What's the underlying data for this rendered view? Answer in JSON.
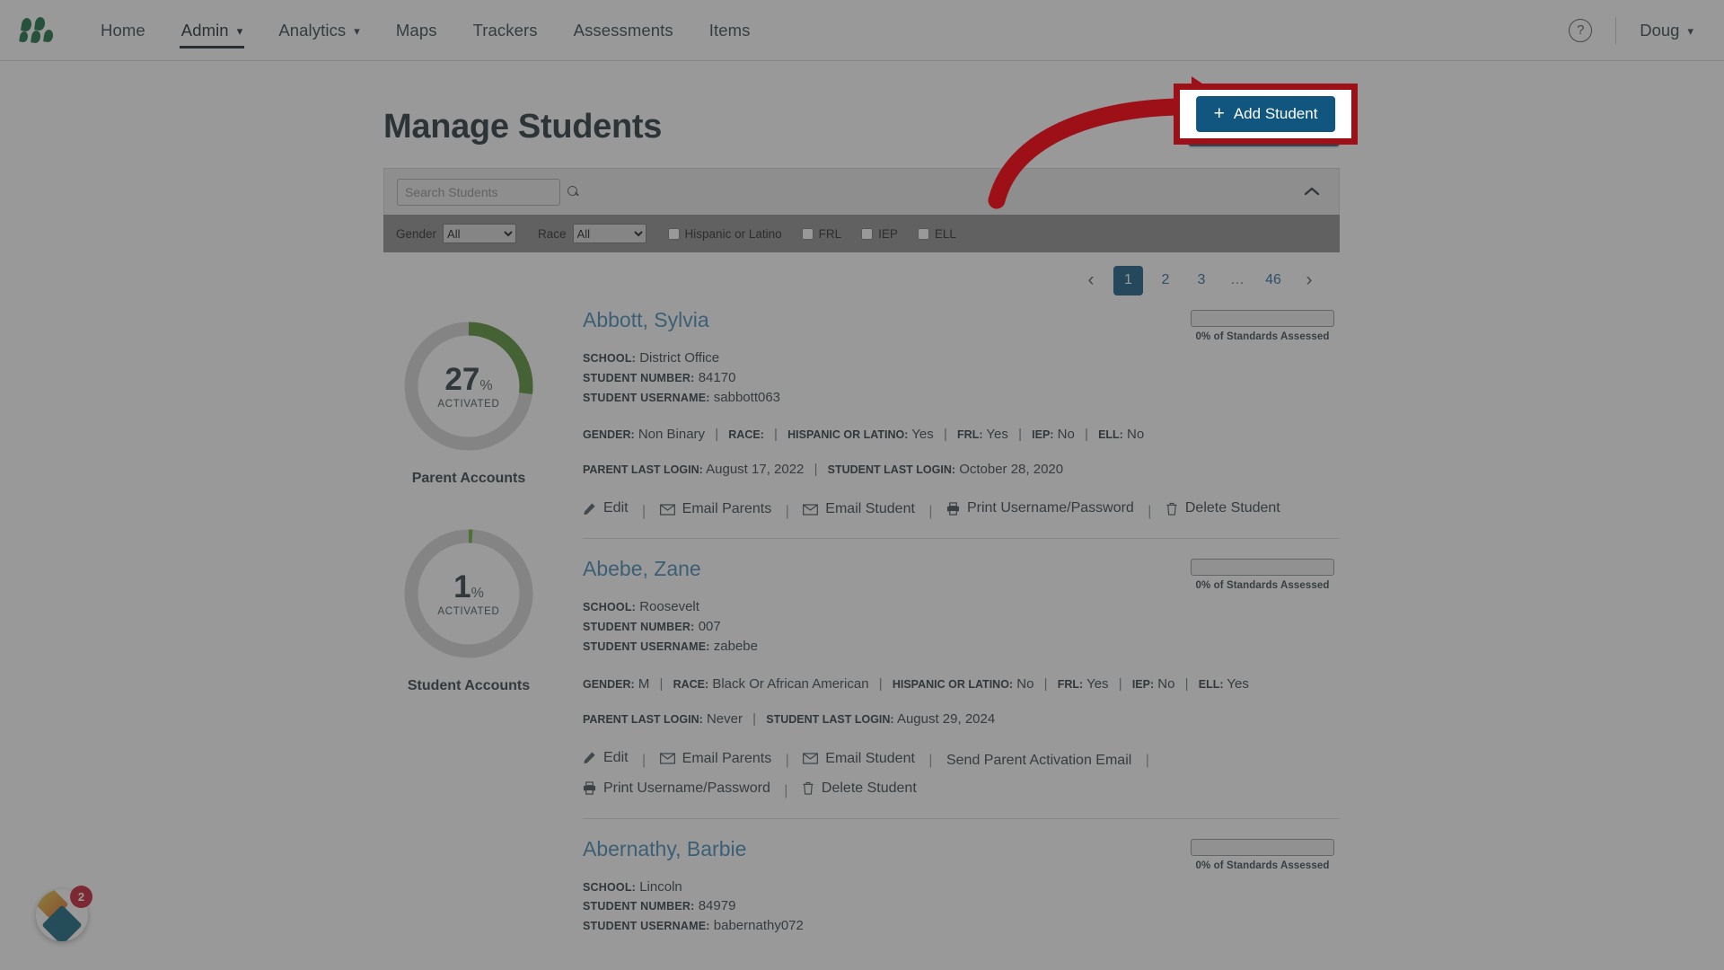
{
  "nav": {
    "logo_name": "masteryconnect-logo",
    "items": [
      {
        "label": "Home",
        "has_caret": false,
        "active": false
      },
      {
        "label": "Admin",
        "has_caret": true,
        "active": true
      },
      {
        "label": "Analytics",
        "has_caret": true,
        "active": false
      },
      {
        "label": "Maps",
        "has_caret": false,
        "active": false
      },
      {
        "label": "Trackers",
        "has_caret": false,
        "active": false
      },
      {
        "label": "Assessments",
        "has_caret": false,
        "active": false
      },
      {
        "label": "Items",
        "has_caret": false,
        "active": false
      }
    ],
    "help_label": "?",
    "user_label": "Doug",
    "caret_glyph": "⌄"
  },
  "header": {
    "title": "Manage Students",
    "add_button": "Add Student",
    "add_button_plus": "+",
    "add_button_color": "#10567f"
  },
  "search": {
    "placeholder": "Search Students",
    "value": "",
    "collapse_glyph": "⌃"
  },
  "filters": {
    "gender_label": "Gender",
    "gender_value": "All",
    "gender_options": [
      "All"
    ],
    "race_label": "Race",
    "race_value": "All",
    "race_options": [
      "All"
    ],
    "checkboxes": [
      {
        "label": "Hispanic or Latino",
        "checked": false
      },
      {
        "label": "FRL",
        "checked": false
      },
      {
        "label": "IEP",
        "checked": false
      },
      {
        "label": "ELL",
        "checked": false
      }
    ]
  },
  "pagination": {
    "prev_glyph": "‹",
    "next_glyph": "›",
    "pages": [
      "1",
      "2",
      "3",
      "…",
      "46"
    ],
    "active": "1"
  },
  "donuts": [
    {
      "value": 27,
      "percent_glyph": "%",
      "status": "ACTIVATED",
      "caption": "Parent Accounts",
      "arc_color": "#4e8c2b",
      "track_color": "#d4d4d4"
    },
    {
      "value": 1,
      "percent_glyph": "%",
      "status": "ACTIVATED",
      "caption": "Student Accounts",
      "arc_color": "#62ad2e",
      "track_color": "#d4d4d4"
    }
  ],
  "labels": {
    "school": "SCHOOL:",
    "student_number": "STUDENT NUMBER:",
    "student_username": "STUDENT USERNAME:",
    "gender": "GENDER:",
    "race": "RACE:",
    "hispanic": "HISPANIC OR LATINO:",
    "frl": "FRL:",
    "iep": "IEP:",
    "ell": "ELL:",
    "parent_last_login": "PARENT LAST LOGIN:",
    "student_last_login": "STUDENT LAST LOGIN:",
    "standards_assessed": "0% of Standards Assessed",
    "separator": "|"
  },
  "students": [
    {
      "name": "Abbott, Sylvia",
      "school": "District Office",
      "student_number": "84170",
      "username": "sabbott063",
      "gender": "Non Binary",
      "race": "",
      "hispanic": "Yes",
      "frl": "Yes",
      "iep": "No",
      "ell": "No",
      "parent_last_login": "August 17, 2022",
      "student_last_login": "October 28, 2020",
      "standards_assessed": "0% of Standards Assessed",
      "actions": [
        {
          "label": "Edit",
          "icon": "pencil-icon"
        },
        {
          "label": "Email Parents",
          "icon": "envelope-icon"
        },
        {
          "label": "Email Student",
          "icon": "envelope-icon"
        },
        {
          "label": "Print Username/Password",
          "icon": "printer-icon"
        },
        {
          "label": "Delete Student",
          "icon": "trash-icon"
        }
      ]
    },
    {
      "name": "Abebe, Zane",
      "school": "Roosevelt",
      "student_number": "007",
      "username": "zabebe",
      "gender": "M",
      "race": "Black Or African American",
      "hispanic": "No",
      "frl": "Yes",
      "iep": "No",
      "ell": "Yes",
      "parent_last_login": "Never",
      "student_last_login": "August 29, 2024",
      "standards_assessed": "0% of Standards Assessed",
      "actions": [
        {
          "label": "Edit",
          "icon": "pencil-icon"
        },
        {
          "label": "Email Parents",
          "icon": "envelope-icon"
        },
        {
          "label": "Email Student",
          "icon": "envelope-icon"
        },
        {
          "label": "Send Parent Activation Email",
          "icon": "none"
        },
        {
          "label": "Print Username/Password",
          "icon": "printer-icon"
        },
        {
          "label": "Delete Student",
          "icon": "trash-icon"
        }
      ]
    },
    {
      "name": "Abernathy, Barbie",
      "school": "Lincoln",
      "student_number": "84979",
      "username": "babernathy072",
      "standards_assessed": "0% of Standards Assessed"
    }
  ],
  "chat": {
    "badge_count": "2",
    "badge_color": "#c2162a"
  },
  "annotation": {
    "highlight_color": "#9d1018",
    "target": "Add Student"
  }
}
